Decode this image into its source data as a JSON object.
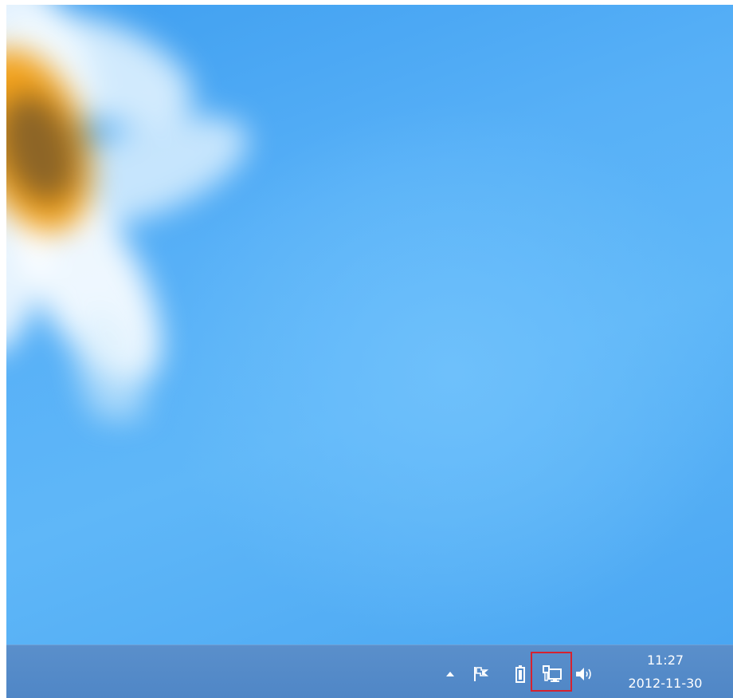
{
  "desktop": {
    "wallpaper": "blue-flower-wallpaper",
    "accent_color": "#57b0f7"
  },
  "taskbar": {
    "background_color": "#5387c7",
    "tray": {
      "icons": [
        {
          "name": "show-hidden-icons-icon"
        },
        {
          "name": "action-center-flag-icon"
        },
        {
          "name": "battery-icon"
        },
        {
          "name": "network-icon"
        },
        {
          "name": "volume-icon"
        }
      ],
      "highlight_color": "#d6222f"
    },
    "clock": {
      "time": "11:27",
      "date": "2012-11-30"
    }
  }
}
